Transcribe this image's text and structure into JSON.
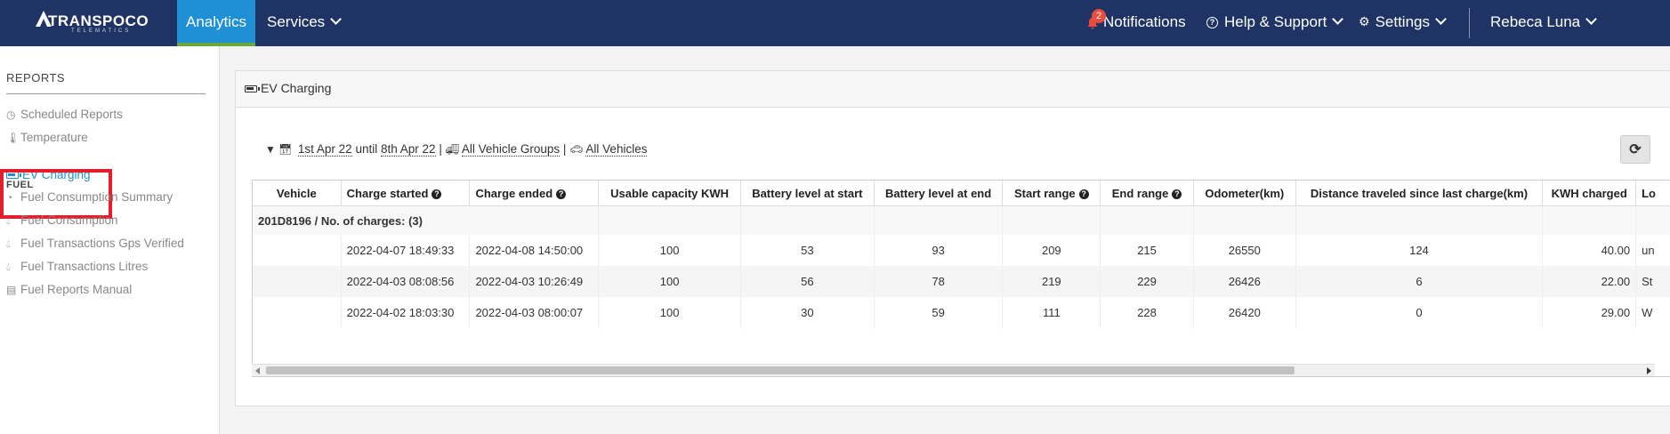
{
  "nav": {
    "logo_text": "TRANSPOCO",
    "logo_sub": "TELEMATICS",
    "analytics": "Analytics",
    "services": "Services",
    "notifications": "Notifications",
    "notification_count": "2",
    "help": "Help & Support",
    "settings": "Settings",
    "user": "Rebeca Luna"
  },
  "sidebar": {
    "section_title": "REPORTS",
    "items_top": [
      {
        "label": "Scheduled Reports",
        "icon": "clock-icon"
      },
      {
        "label": "Temperature",
        "icon": "thermometer-icon"
      }
    ],
    "category": "FUEL",
    "active_item": "EV Charging",
    "items_fuel": [
      {
        "label": "Fuel Consumption Summary",
        "icon": "dashboard-icon"
      },
      {
        "label": "Fuel Consumption",
        "icon": "drop-icon"
      },
      {
        "label": "Fuel Transactions Gps Verified",
        "icon": "drop-icon"
      },
      {
        "label": "Fuel Transactions Litres",
        "icon": "drop-icon"
      },
      {
        "label": "Fuel Reports Manual",
        "icon": "book-icon"
      }
    ]
  },
  "panel": {
    "title": "EV Charging",
    "filters": {
      "date_from": "1st Apr 22",
      "until": "until",
      "date_to": "8th Apr 22",
      "sep": "|",
      "vehicle_groups": "All Vehicle Groups",
      "vehicles": "All Vehicles"
    }
  },
  "table": {
    "headers": [
      "Vehicle",
      "Charge started",
      "Charge ended",
      "Usable capacity KWH",
      "Battery level at start",
      "Battery level at end",
      "Start range",
      "End range",
      "Odometer(km)",
      "Distance traveled since last charge(km)",
      "KWH charged",
      "Lo"
    ],
    "group_label": "201D8196 / No. of charges: (3)",
    "rows": [
      [
        "",
        "2022-04-07 18:49:33",
        "2022-04-08 14:50:00",
        "100",
        "53",
        "93",
        "209",
        "215",
        "26550",
        "124",
        "40.00",
        "un"
      ],
      [
        "",
        "2022-04-03 08:08:56",
        "2022-04-03 10:26:49",
        "100",
        "56",
        "78",
        "219",
        "229",
        "26426",
        "6",
        "22.00",
        "St"
      ],
      [
        "",
        "2022-04-02 18:03:30",
        "2022-04-03 08:00:07",
        "100",
        "30",
        "59",
        "111",
        "228",
        "26420",
        "0",
        "29.00",
        "W"
      ]
    ]
  },
  "colors": {
    "nav_bg": "#1f3465",
    "active_tab": "#1f8fd6",
    "active_underline": "#6aa83b",
    "badge": "#e74c3c",
    "highlight": "#e41e2a",
    "link_active": "#1f8fd6"
  }
}
